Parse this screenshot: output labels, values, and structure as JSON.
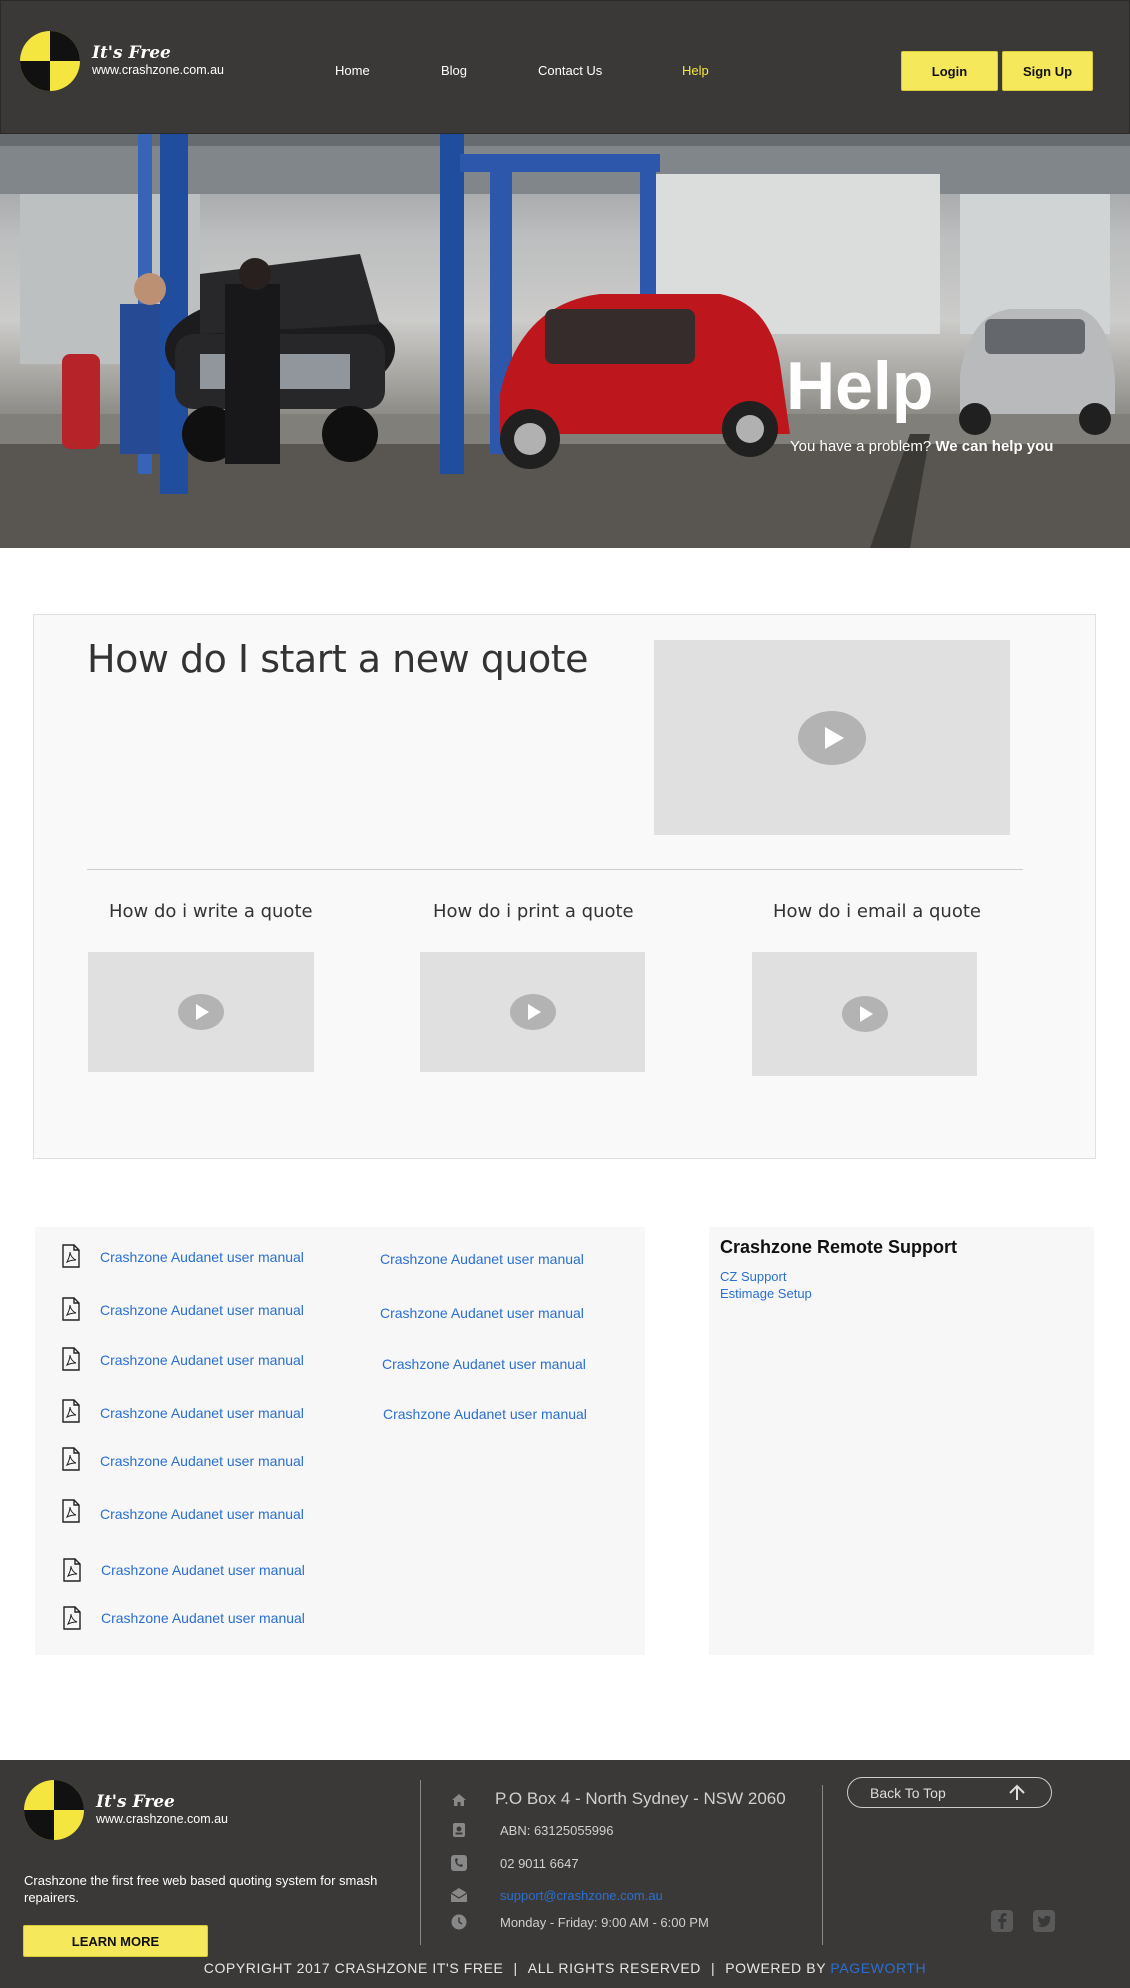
{
  "header": {
    "logo_script": "It's Free",
    "logo_url": "www.crashzone.com.au",
    "nav": [
      {
        "label": "Home"
      },
      {
        "label": "Blog"
      },
      {
        "label": "Contact Us"
      },
      {
        "label": "Help"
      }
    ],
    "login_label": "Login",
    "signup_label": "Sign Up"
  },
  "hero": {
    "title": "Help",
    "subtitle_plain": "You have a problem? ",
    "subtitle_bold": "We can help you"
  },
  "videos": {
    "main_question": "How do I start a new quote",
    "items": [
      {
        "title": "How do i write a quote"
      },
      {
        "title": "How do i print a quote"
      },
      {
        "title": "How do i email a quote"
      }
    ]
  },
  "manuals": {
    "left": [
      "Crashzone Audanet user manual",
      "Crashzone Audanet user manual",
      "Crashzone Audanet user manual",
      "Crashzone Audanet user manual",
      "Crashzone Audanet user manual",
      "Crashzone Audanet user manual",
      "Crashzone Audanet user manual",
      "Crashzone Audanet user manual"
    ],
    "right": [
      "Crashzone Audanet user manual",
      "Crashzone Audanet user manual",
      "Crashzone Audanet user manual",
      "Crashzone Audanet user manual"
    ]
  },
  "support": {
    "title": "Crashzone Remote Support",
    "links": [
      "CZ Support",
      "Estimage Setup"
    ]
  },
  "footer": {
    "logo_script": "It's Free",
    "logo_url": "www.crashzone.com.au",
    "description": "Crashzone the first free web based quoting system for smash repairers.",
    "learn_more": "LEARN MORE",
    "address": "P.O Box 4 - North Sydney - NSW 2060",
    "abn": "ABN: 63125055996",
    "phone": "02 9011 6647",
    "email": "support@crashzone.com.au",
    "hours": "Monday - Friday: 9:00 AM - 6:00 PM",
    "back_to_top": "Back To Top",
    "copyright": "COPYRIGHT 2017 CRASHZONE IT'S FREE",
    "rights": "ALL RIGHTS RESERVED",
    "powered_by": "POWERED BY ",
    "powered_name": "PAGEWORTH",
    "separator": "|"
  },
  "colors": {
    "header_bg": "#3a3938",
    "accent_yellow": "#f5e85a",
    "link_blue": "#2a6fd1",
    "panel_bg": "#f9f9f9"
  },
  "icons": {
    "file": "pdf-file-icon",
    "home": "home-icon",
    "id": "id-card-icon",
    "phone": "phone-icon",
    "mail": "envelope-icon",
    "clock": "clock-icon",
    "facebook": "facebook-icon",
    "twitter": "twitter-icon"
  }
}
